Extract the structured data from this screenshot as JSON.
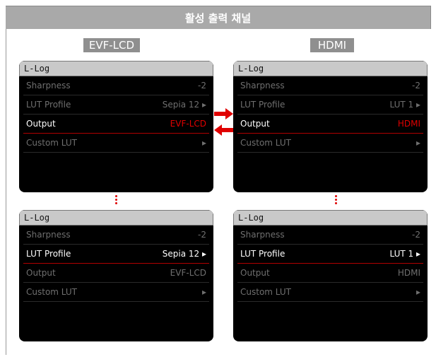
{
  "header": {
    "title": "활성 출력 채널"
  },
  "columns": {
    "left_label": "EVF-LCD",
    "right_label": "HDMI"
  },
  "screens": [
    {
      "title": "L-Log",
      "rows": [
        {
          "label": "Sharpness",
          "value": "-2"
        },
        {
          "label": "LUT Profile",
          "value": "Sepia 12 ▸"
        },
        {
          "label": "Output",
          "value": "EVF-LCD"
        },
        {
          "label": "Custom LUT",
          "value": "▸"
        }
      ]
    },
    {
      "title": "L-Log",
      "rows": [
        {
          "label": "Sharpness",
          "value": "-2"
        },
        {
          "label": "LUT Profile",
          "value": "LUT 1 ▸"
        },
        {
          "label": "Output",
          "value": "HDMI"
        },
        {
          "label": "Custom LUT",
          "value": "▸"
        }
      ]
    },
    {
      "title": "L-Log",
      "rows": [
        {
          "label": "Sharpness",
          "value": "-2"
        },
        {
          "label": "LUT Profile",
          "value": "Sepia 12 ▸"
        },
        {
          "label": "Output",
          "value": "EVF-LCD"
        },
        {
          "label": "Custom LUT",
          "value": "▸"
        }
      ]
    },
    {
      "title": "L-Log",
      "rows": [
        {
          "label": "Sharpness",
          "value": "-2"
        },
        {
          "label": "LUT Profile",
          "value": "LUT 1 ▸"
        },
        {
          "label": "Output",
          "value": "HDMI"
        },
        {
          "label": "Custom LUT",
          "value": "▸"
        }
      ]
    }
  ],
  "colors": {
    "accent": "#e00000",
    "header_bg": "#a9a9a9",
    "screen_bg": "#000000"
  },
  "icons": [
    "arrow-right-icon",
    "arrow-left-icon",
    "ellipsis-vertical-icon",
    "chevron-right-icon"
  ]
}
